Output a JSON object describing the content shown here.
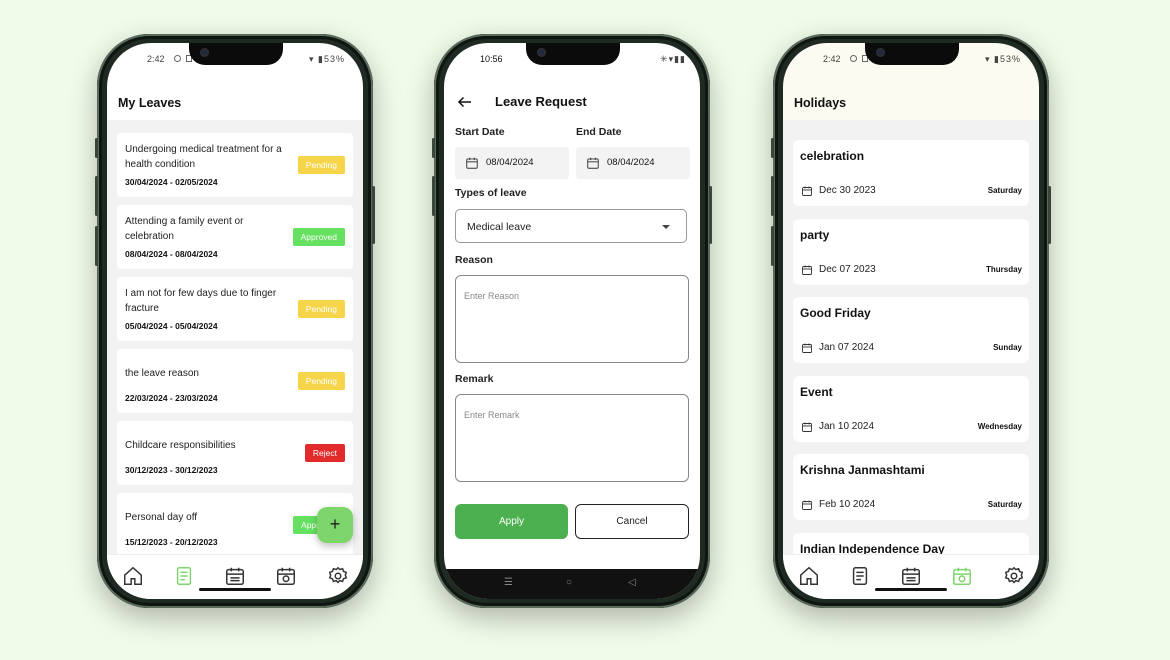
{
  "colors": {
    "background": "#f1fbe9",
    "accent": "#4caf50",
    "pending": "#f7d54a",
    "approved": "#66e061",
    "reject": "#e12a2a",
    "active_nav": "#7ed56c"
  },
  "phone1": {
    "status_time": "2:42",
    "status_battery": "53%",
    "title": "My Leaves",
    "leaves": [
      {
        "reason": "Undergoing medical treatment for a health condition",
        "dates": "30/04/2024 - 02/05/2024",
        "status": "Pending"
      },
      {
        "reason": "Attending a family event or celebration",
        "dates": "08/04/2024 - 08/04/2024",
        "status": "Approved"
      },
      {
        "reason": "I am not for few days due to finger fracture",
        "dates": "05/04/2024 - 05/04/2024",
        "status": "Pending"
      },
      {
        "reason": "the leave reason",
        "dates": "22/03/2024 - 23/03/2024",
        "status": "Pending"
      },
      {
        "reason": "Childcare responsibilities",
        "dates": "30/12/2023 - 30/12/2023",
        "status": "Reject"
      },
      {
        "reason": "Personal day off",
        "dates": "15/12/2023 - 20/12/2023",
        "status": "Appr"
      }
    ],
    "fab_label": "+",
    "nav_icons": [
      "home-icon",
      "document-list-icon",
      "calendar-icon",
      "holiday-calendar-icon",
      "gear-icon"
    ],
    "active_nav_index": 1
  },
  "phone2": {
    "status_time": "10:56",
    "title": "Leave Request",
    "start_date_label": "Start Date",
    "end_date_label": "End Date",
    "start_date": "08/04/2024",
    "end_date": "08/04/2024",
    "type_label": "Types of leave",
    "type_value": "Medical leave",
    "reason_label": "Reason",
    "reason_placeholder": "Enter Reason",
    "remark_label": "Remark",
    "remark_placeholder": "Enter Remark",
    "apply_label": "Apply",
    "cancel_label": "Cancel"
  },
  "phone3": {
    "status_time": "2:42",
    "status_battery": "53%",
    "title": "Holidays",
    "holidays": [
      {
        "name": "celebration",
        "date": "Dec 30 2023",
        "day": "Saturday"
      },
      {
        "name": "party",
        "date": "Dec 07 2023",
        "day": "Thursday"
      },
      {
        "name": "Good Friday",
        "date": "Jan 07 2024",
        "day": "Sunday"
      },
      {
        "name": "Event",
        "date": "Jan 10 2024",
        "day": "Wednesday"
      },
      {
        "name": "Krishna Janmashtami",
        "date": "Feb 10 2024",
        "day": "Saturday"
      },
      {
        "name": "Indian Independence Day",
        "date": "",
        "day": ""
      }
    ],
    "nav_icons": [
      "home-icon",
      "document-list-icon",
      "calendar-icon",
      "holiday-calendar-icon",
      "gear-icon"
    ],
    "active_nav_index": 3
  }
}
